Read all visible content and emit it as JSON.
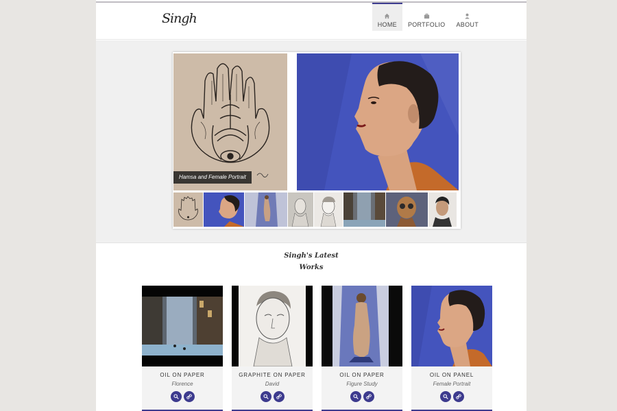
{
  "site": {
    "logo_text": "Singh"
  },
  "nav": [
    {
      "label": "HOME",
      "icon": "home-icon",
      "active": true
    },
    {
      "label": "PORTFOLIO",
      "icon": "briefcase-icon",
      "active": false
    },
    {
      "label": "ABOUT",
      "icon": "user-icon",
      "active": false
    }
  ],
  "slider": {
    "caption": "Hamsa and Female Portrait",
    "thumbnails": [
      "Hamsa",
      "Female Portrait",
      "Figure Study",
      "Bust Sketch",
      "David",
      "Florence",
      "Masked Figure",
      "Male Portrait"
    ]
  },
  "latest": {
    "title_line1": "Singh's Latest",
    "title_line2": "Works",
    "cards": [
      {
        "medium": "OIL ON PAPER",
        "title": "Florence"
      },
      {
        "medium": "GRAPHITE ON PAPER",
        "title": "David"
      },
      {
        "medium": "OIL ON PAPER",
        "title": "Figure Study"
      },
      {
        "medium": "OIL ON PANEL",
        "title": "Female Portrait"
      }
    ]
  },
  "colors": {
    "accent": "#3d3b8e",
    "background": "#e8e6e3",
    "band": "#f0f0f0"
  }
}
